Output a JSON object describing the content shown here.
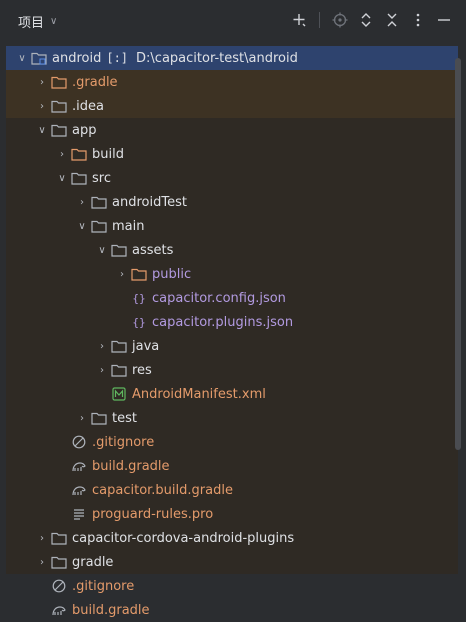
{
  "header": {
    "title": "项目",
    "icons": [
      "add-icon",
      "locate-icon",
      "expand-all-icon",
      "collapse-all-icon",
      "more-icon",
      "minimize-icon"
    ]
  },
  "tree": {
    "root": {
      "label": "android",
      "marker": "[:]",
      "path": "D:\\capacitor-test\\android"
    },
    "items": [
      {
        "label": ".gradle"
      },
      {
        "label": ".idea"
      },
      {
        "label": "app"
      },
      {
        "label": "build"
      },
      {
        "label": "src"
      },
      {
        "label": "androidTest"
      },
      {
        "label": "main"
      },
      {
        "label": "assets"
      },
      {
        "label": "public"
      },
      {
        "label": "capacitor.config.json"
      },
      {
        "label": "capacitor.plugins.json"
      },
      {
        "label": "java"
      },
      {
        "label": "res"
      },
      {
        "label": "AndroidManifest.xml"
      },
      {
        "label": "test"
      },
      {
        "label": ".gitignore"
      },
      {
        "label": "build.gradle"
      },
      {
        "label": "capacitor.build.gradle"
      },
      {
        "label": "proguard-rules.pro"
      },
      {
        "label": "capacitor-cordova-android-plugins"
      },
      {
        "label": "gradle"
      },
      {
        "label": ".gitignore"
      },
      {
        "label": "build.gradle"
      }
    ]
  },
  "colors": {
    "background": "#2b2d30",
    "selection": "#2e436e",
    "excluded_bg": "#3d3223",
    "orange_text": "#e49b6b",
    "purple_text": "#b29ae0"
  }
}
